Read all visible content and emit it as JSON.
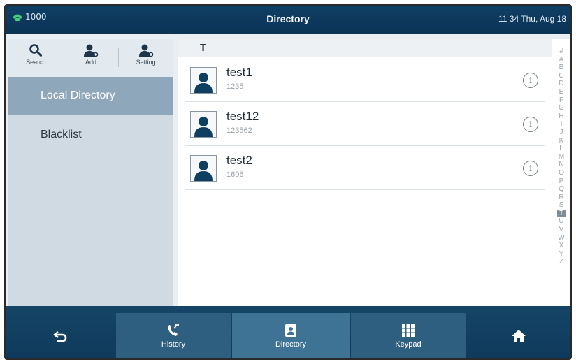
{
  "status": {
    "line": "1000",
    "title": "Directory",
    "datetime": "11 34 Thu, Aug 18"
  },
  "colors": {
    "accent_green": "#3fd07a",
    "status_bar": "#0f3f66",
    "selected_item": "#8fa7bb"
  },
  "sidebar": {
    "tools": [
      {
        "label": "Search",
        "icon": "search-icon"
      },
      {
        "label": "Add",
        "icon": "add-contact-icon"
      },
      {
        "label": "Setting",
        "icon": "contact-settings-icon"
      }
    ],
    "items": [
      {
        "label": "Local Directory",
        "selected": true
      },
      {
        "label": "Blacklist",
        "selected": false
      }
    ]
  },
  "list": {
    "group": "T",
    "contacts": [
      {
        "name": "test1",
        "number": "1235"
      },
      {
        "name": "test12",
        "number": "123562"
      },
      {
        "name": "test2",
        "number": "1606"
      }
    ]
  },
  "alphabet": {
    "letters": [
      "#",
      "A",
      "B",
      "C",
      "D",
      "E",
      "F",
      "G",
      "H",
      "I",
      "J",
      "K",
      "L",
      "M",
      "N",
      "O",
      "P",
      "Q",
      "R",
      "S",
      "T",
      "U",
      "V",
      "W",
      "X",
      "Y",
      "Z"
    ],
    "selected": "T"
  },
  "softkeys": [
    {
      "label": "",
      "icon": "back-icon"
    },
    {
      "label": "History",
      "icon": "history-icon"
    },
    {
      "label": "Directory",
      "icon": "directory-icon",
      "active": true
    },
    {
      "label": "Keypad",
      "icon": "keypad-icon"
    },
    {
      "label": "",
      "icon": "home-icon"
    }
  ]
}
